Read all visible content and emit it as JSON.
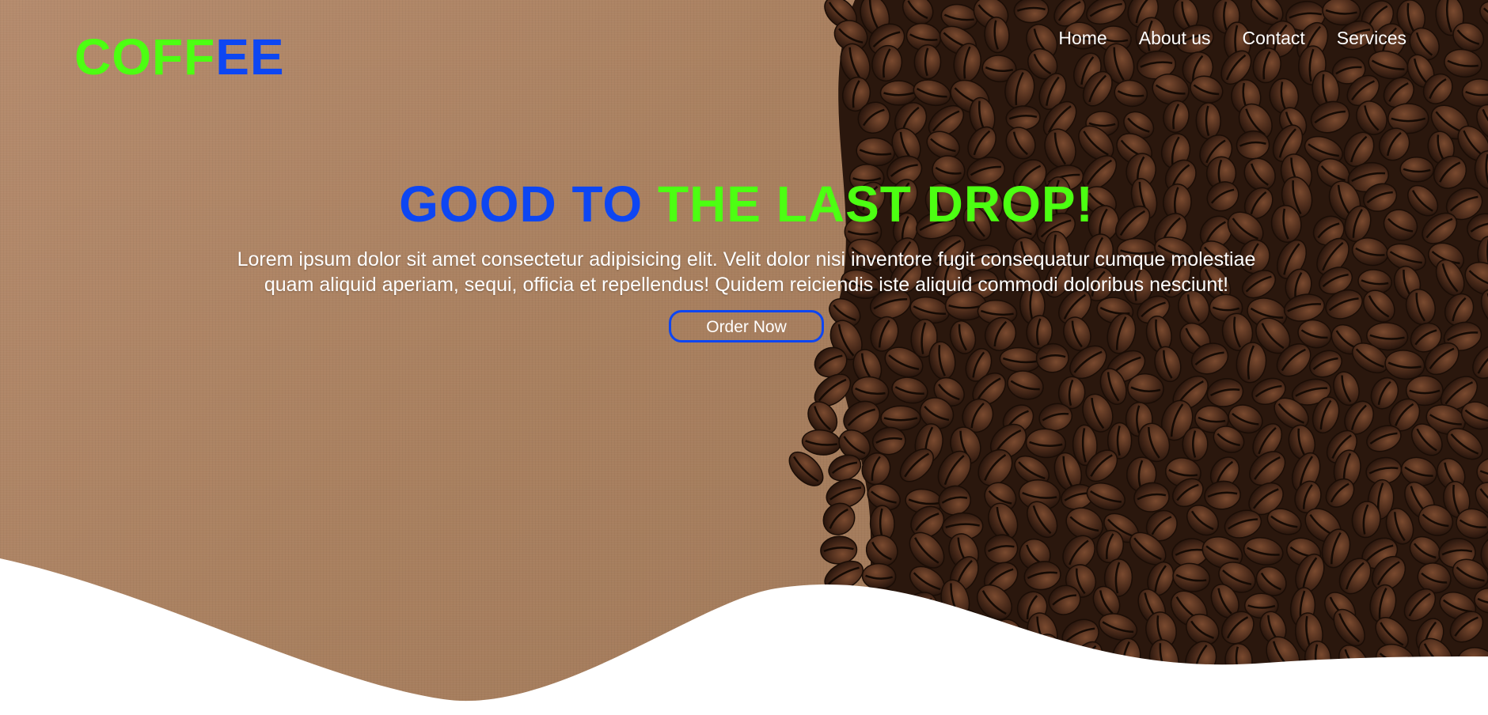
{
  "brand": {
    "logo_part1": "COFF",
    "logo_part2": "EE",
    "color_green": "#4cff12",
    "color_blue": "#0d46f2"
  },
  "nav": {
    "items": [
      {
        "label": "Home"
      },
      {
        "label": "About us"
      },
      {
        "label": "Contact"
      },
      {
        "label": "Services"
      }
    ]
  },
  "hero": {
    "headline_part1": "GOOD TO ",
    "headline_part2": "THE LAST DROP!",
    "description": "Lorem ipsum dolor sit amet consectetur adipisicing elit. Velit dolor nisi inventore fugit consequatur cumque molestiae quam aliquid aperiam, sequi, officia et repellendus! Quidem reiciendis iste aliquid commodi doloribus nesciunt!",
    "cta_label": "Order Now",
    "background": "coffee-beans-on-kraft-paper"
  }
}
